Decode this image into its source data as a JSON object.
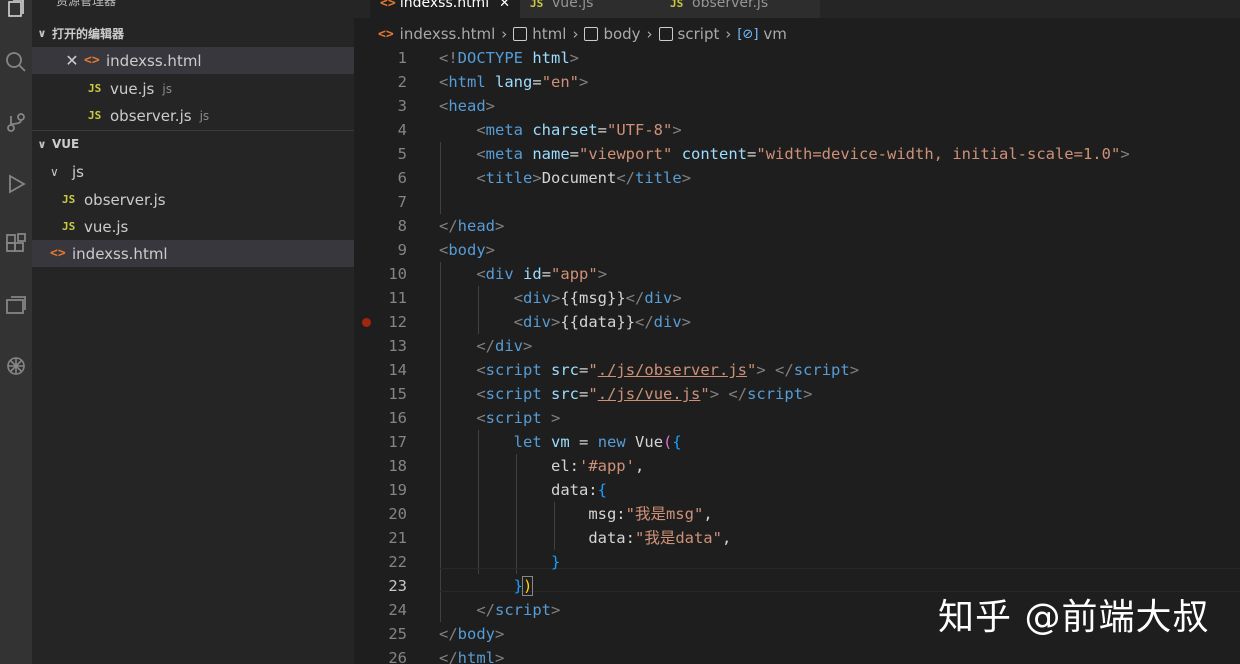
{
  "sidebar": {
    "title": "资源管理器",
    "open_editors": {
      "header": "打开的编辑器",
      "items": [
        {
          "name": "indexss.html",
          "desc": ""
        },
        {
          "name": "vue.js",
          "desc": "js"
        },
        {
          "name": "observer.js",
          "desc": "js"
        }
      ]
    },
    "workspace": {
      "header": "VUE",
      "folder": "js",
      "files": [
        "observer.js",
        "vue.js"
      ],
      "root_file": "indexss.html"
    }
  },
  "tabs": [
    {
      "label": "indexss.html",
      "close": "✕"
    },
    {
      "label": "vue.js"
    },
    {
      "label": "observer.js"
    }
  ],
  "breadcrumb": [
    "indexss.html",
    "html",
    "body",
    "script",
    "vm"
  ],
  "line_numbers": [
    "1",
    "2",
    "3",
    "4",
    "5",
    "6",
    "7",
    "8",
    "9",
    "10",
    "11",
    "12",
    "13",
    "14",
    "15",
    "16",
    "17",
    "18",
    "19",
    "20",
    "21",
    "22",
    "23",
    "24",
    "25",
    "26"
  ],
  "watermark": "知乎 @前端大叔",
  "colors": {
    "html_icon": "#e37933",
    "js_icon": "#cbcb41",
    "breakpoint": "#a1260d"
  }
}
